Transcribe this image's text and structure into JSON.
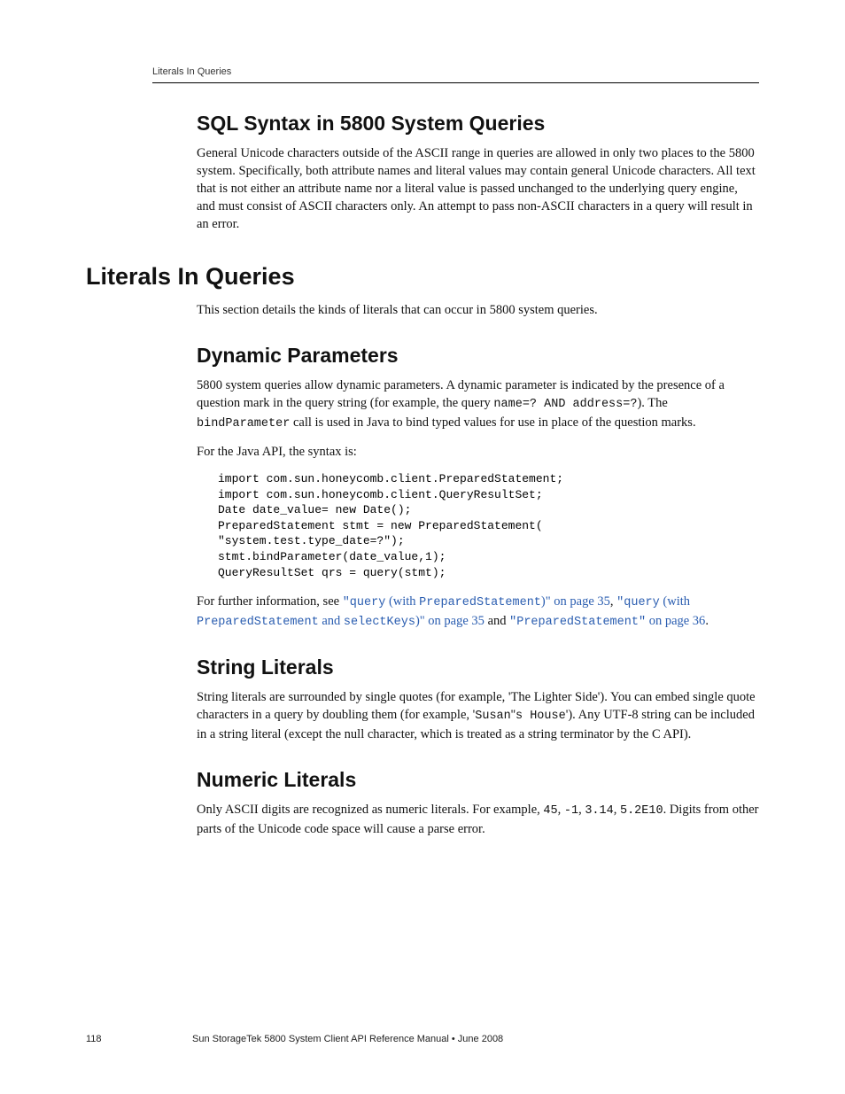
{
  "runningHead": "Literals In Queries",
  "sec1": {
    "heading": "SQL Syntax in 5800 System Queries",
    "para1": "General Unicode characters outside of the ASCII range in queries are allowed in only two places to the 5800 system. Specifically, both attribute names and literal values may contain general Unicode characters. All text that is not either an attribute name nor a literal value is passed unchanged to the underlying query engine, and must consist of ASCII characters only. An attempt to pass non-ASCII characters in a query will result in an error."
  },
  "sec2": {
    "heading": "Literals In Queries",
    "intro": "This section details the kinds of literals that can occur in 5800 system queries."
  },
  "dyn": {
    "heading": "Dynamic Parameters",
    "p1_a": "5800 system queries allow dynamic parameters. A dynamic parameter is indicated by the presence of a question mark in the query string (for example, the query ",
    "code1": "name=? AND address=?",
    "p1_b": "). The ",
    "code2": "bindParameter",
    "p1_c": " call is used in Java to bind typed values for use in place of the question marks.",
    "p2": "For the Java API, the syntax is:",
    "code_block": "import com.sun.honeycomb.client.PreparedStatement;\nimport com.sun.honeycomb.client.QueryResultSet;\nDate date_value= new Date();\nPreparedStatement stmt = new PreparedStatement(\n\"system.test.type_date=?\");\nstmt.bindParameter(date_value,1);\nQueryResultSet qrs = query(stmt);",
    "p3_a": "For further information, see ",
    "link1_a": "\"query",
    "link1_b": " (with ",
    "link1_c": "PreparedStatement",
    "link1_d": ")\" on page 35",
    "sep1": ", ",
    "link2_a": "\"query",
    "link2_b": " (with ",
    "link2_c": "PreparedStatement",
    "link2_d": " and ",
    "link2_e": "selectKeys",
    "link2_f": ")\" on page 35",
    "sep2": " and ",
    "link3_a": "\"PreparedStatement\"",
    "link3_b": " on page 36",
    "p3_end": "."
  },
  "str": {
    "heading": "String Literals",
    "p1_a": "String literals are surrounded by single quotes (for example, 'The Lighter Side'). You can embed single quote characters in a query by doubling them (for example, '",
    "code1": "Susan",
    "p1_b": "''",
    "code2": "s House",
    "p1_c": "'). Any UTF-8 string can be included in a string literal (except the null character, which is treated as a string terminator by the C API)."
  },
  "num": {
    "heading": "Numeric Literals",
    "p1_a": "Only ASCII digits are recognized as numeric literals. For example, ",
    "code1": "45",
    "sep1": ", ",
    "code2": "-1",
    "sep2": ", ",
    "code3": "3.14",
    "sep3": ", ",
    "code4": "5.2E10",
    "p1_b": ". Digits from other parts of the Unicode code space will cause a parse error."
  },
  "footer": {
    "pageNum": "118",
    "title": "Sun StorageTek 5800 System Client API Reference Manual   •   June 2008"
  }
}
